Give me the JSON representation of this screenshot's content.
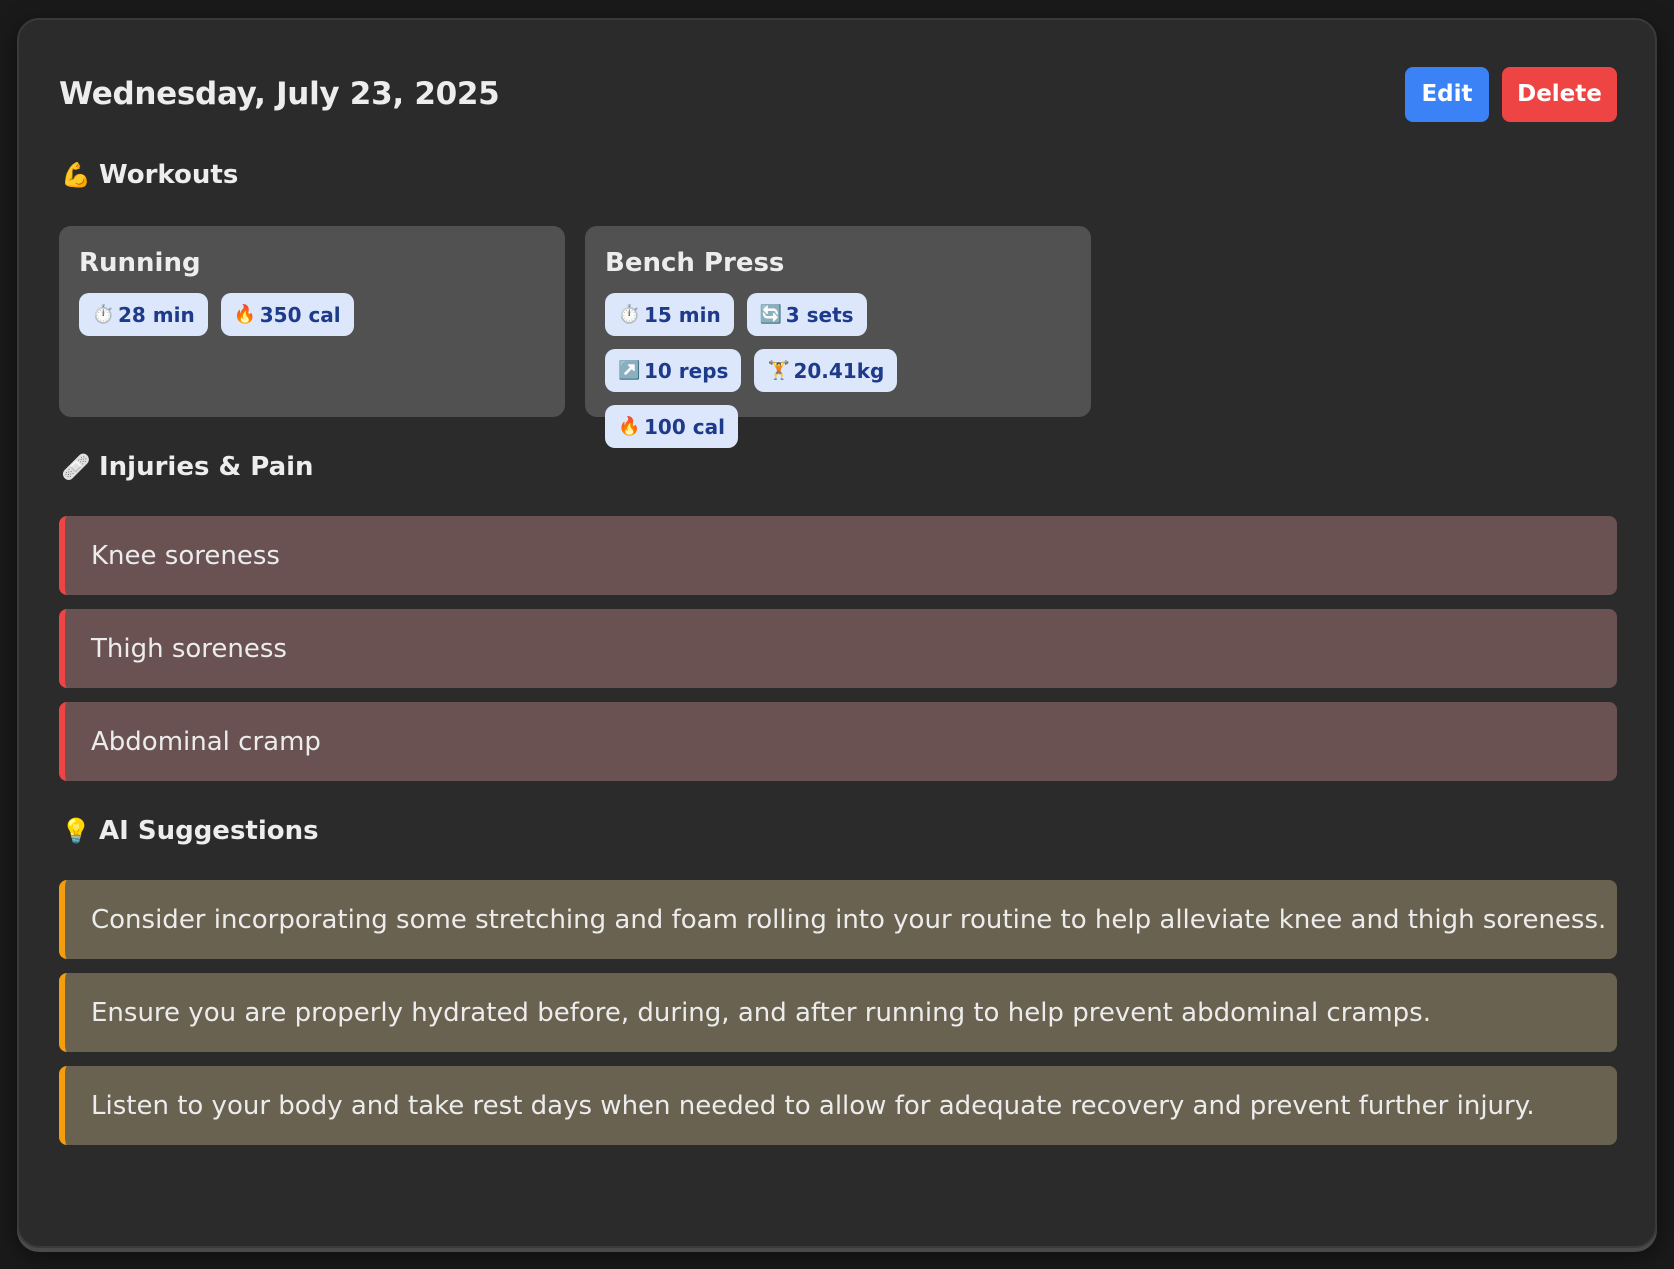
{
  "header": {
    "date": "Wednesday, July 23, 2025",
    "edit_label": "Edit",
    "delete_label": "Delete"
  },
  "colors": {
    "edit": "#3b82f6",
    "delete": "#ef4444",
    "injury_accent": "#ef4444",
    "suggestion_accent": "#f59e0b"
  },
  "workouts": {
    "icon": "💪",
    "title": "Workouts",
    "items": [
      {
        "name": "Running",
        "stats": [
          {
            "icon": "⏱️",
            "icon_name": "stopwatch-icon",
            "label": "28 min"
          },
          {
            "icon": "🔥",
            "icon_name": "fire-icon",
            "label": "350 cal"
          }
        ]
      },
      {
        "name": "Bench Press",
        "stats": [
          {
            "icon": "⏱️",
            "icon_name": "stopwatch-icon",
            "label": "15 min"
          },
          {
            "icon": "🔄",
            "icon_name": "repeat-icon",
            "label": "3 sets"
          },
          {
            "icon": "↗️",
            "icon_name": "arrow-up-right-icon",
            "label": "10 reps"
          },
          {
            "icon": "🏋️",
            "icon_name": "weightlifter-icon",
            "label": "20.41kg"
          },
          {
            "icon": "🔥",
            "icon_name": "fire-icon",
            "label": "100 cal"
          }
        ]
      }
    ]
  },
  "injuries": {
    "icon": "🩹",
    "title": "Injuries & Pain",
    "items": [
      "Knee soreness",
      "Thigh soreness",
      "Abdominal cramp"
    ]
  },
  "suggestions": {
    "icon": "💡",
    "title": "AI Suggestions",
    "items": [
      "Consider incorporating some stretching and foam rolling into your routine to help alleviate knee and thigh soreness.",
      "Ensure you are properly hydrated before, during, and after running to help prevent abdominal cramps.",
      "Listen to your body and take rest days when needed to allow for adequate recovery and prevent further injury."
    ]
  }
}
